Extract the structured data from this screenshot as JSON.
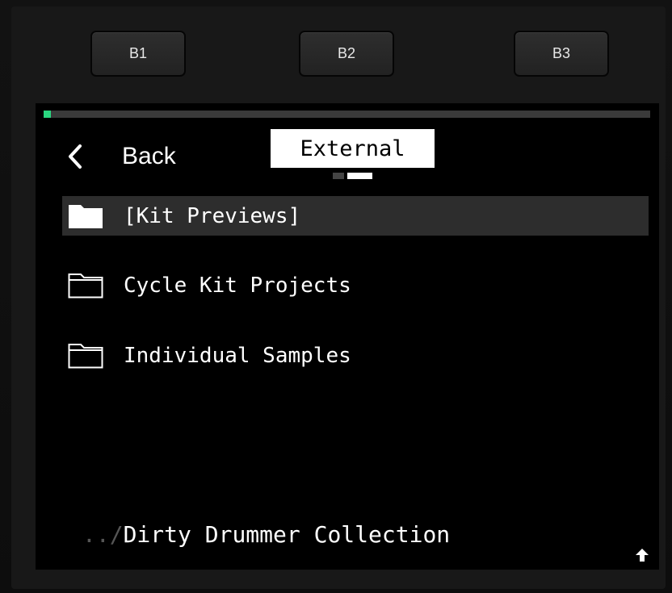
{
  "hardware_buttons": [
    {
      "label": "B1"
    },
    {
      "label": "B2"
    },
    {
      "label": "B3"
    }
  ],
  "screen": {
    "progress": 0.01,
    "accent_color": "#2ad67f",
    "back": {
      "label": "Back",
      "icon": "chevron-left-icon"
    },
    "tab_title": "External",
    "page_indicator": {
      "count": 2,
      "active_index": 1
    },
    "items": [
      {
        "label": "[Kit Previews]",
        "icon": "folder-filled-icon",
        "selected": true
      },
      {
        "label": "Cycle Kit Projects",
        "icon": "folder-outline-icon",
        "selected": false
      },
      {
        "label": "Individual Samples",
        "icon": "folder-outline-icon",
        "selected": false
      }
    ],
    "path": {
      "prefix": "../",
      "name": "Dirty Drummer Collection"
    },
    "up_icon": "arrow-up-icon"
  }
}
